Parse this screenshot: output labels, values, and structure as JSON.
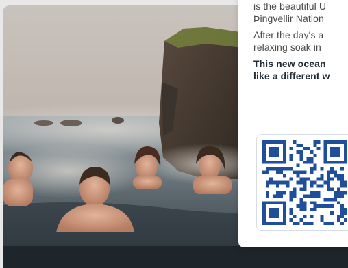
{
  "card": {
    "paragraph1": {
      "line1": "is the beautiful U",
      "line2": "Þingvellir Nation"
    },
    "paragraph2": {
      "line1": "After the day's a",
      "line2": "relaxing soak in "
    },
    "highlight": {
      "line1": "This new ocean",
      "line2": "like a different w"
    }
  },
  "colors": {
    "card_background": "#ffffff",
    "body_text": "#4a4a4a",
    "bold_text": "#1f2a33",
    "qr_color": "#1f4e9a",
    "qr_border": "#d6dde4"
  },
  "icons": {
    "qr": "qr-code-icon"
  }
}
